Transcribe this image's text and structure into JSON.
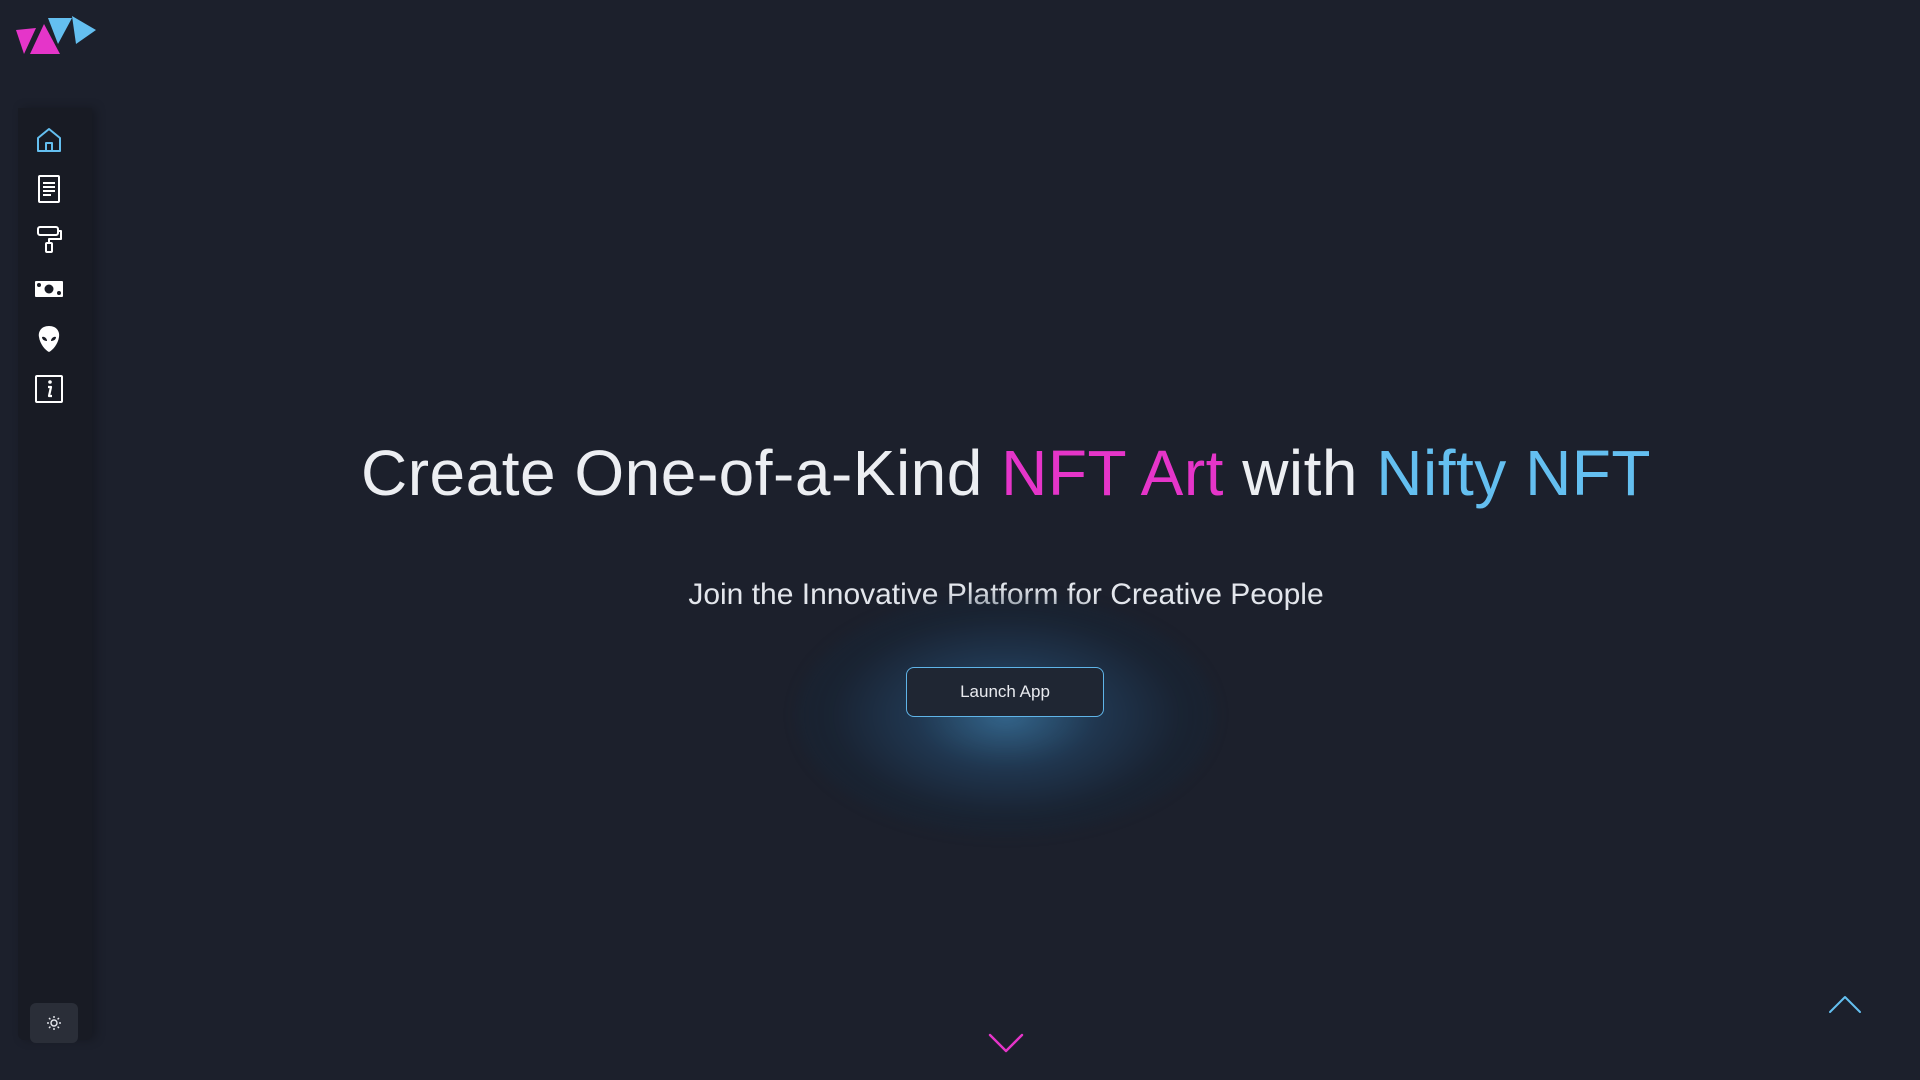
{
  "brand": {
    "logo_icon": "triangles-logo-icon",
    "colors": {
      "pink": "#e535c9",
      "blue": "#64bff0",
      "background": "#1c202c"
    }
  },
  "sidebar": {
    "items": [
      {
        "name": "home",
        "icon": "home-icon",
        "active": true
      },
      {
        "name": "docs",
        "icon": "document-icon",
        "active": false
      },
      {
        "name": "create",
        "icon": "paint-roller-icon",
        "active": false
      },
      {
        "name": "market",
        "icon": "money-icon",
        "active": false
      },
      {
        "name": "profile",
        "icon": "alien-icon",
        "active": false
      },
      {
        "name": "about",
        "icon": "info-icon",
        "active": false
      }
    ],
    "theme_toggle_icon": "sun-icon"
  },
  "hero": {
    "title_part1": "Create One-of-a-Kind ",
    "title_highlight1": "NFT Art",
    "title_part2": " with ",
    "title_highlight2": "Nifty NFT",
    "subtitle": "Join the Innovative Platform for Creative People",
    "cta_label": "Launch App"
  },
  "controls": {
    "scroll_down_icon": "chevron-down-icon",
    "scroll_top_icon": "chevron-up-icon"
  }
}
